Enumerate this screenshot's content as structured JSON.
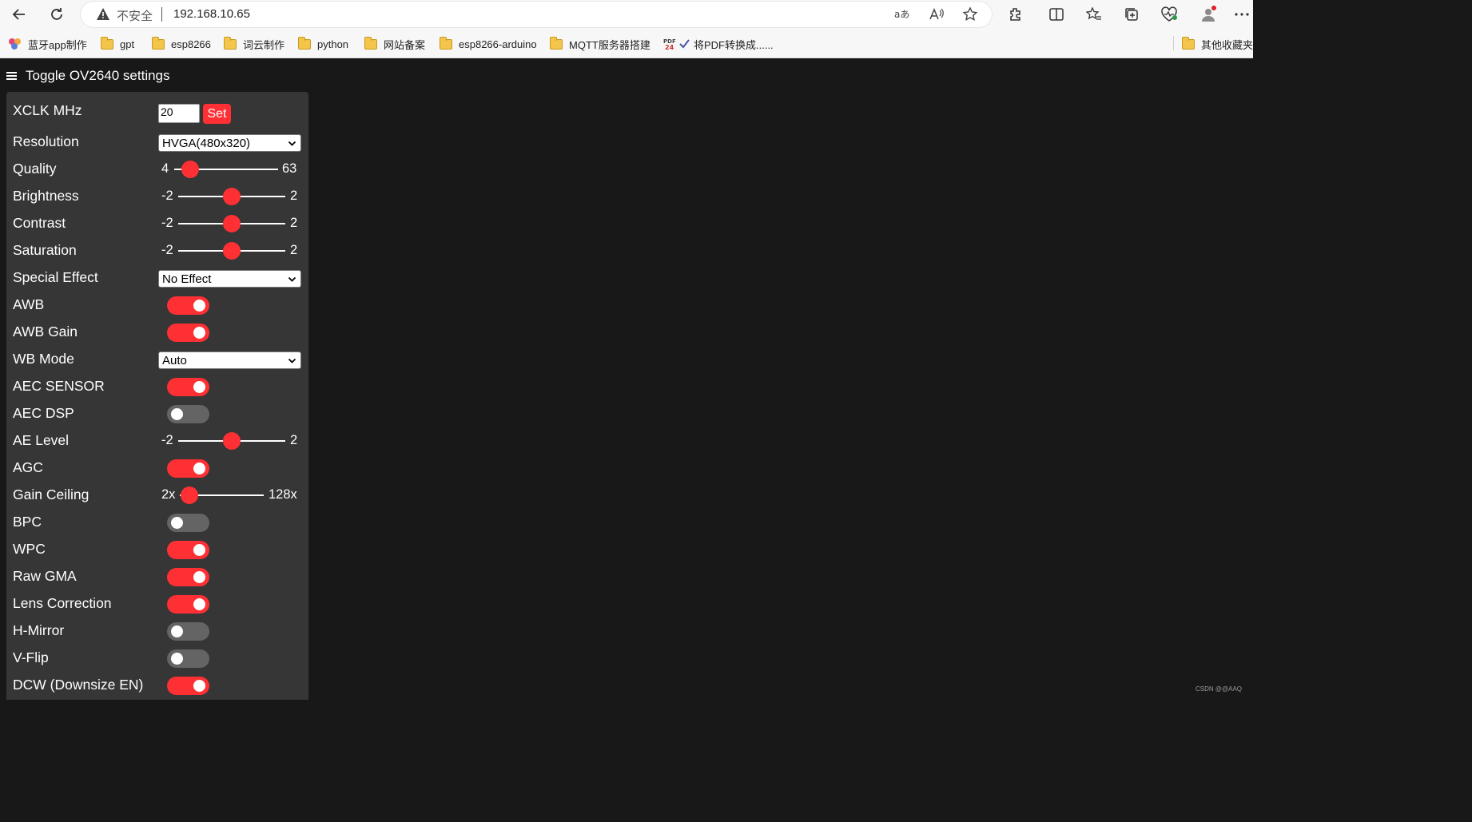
{
  "browser": {
    "insecure_label": "不安全",
    "url": "192.168.10.65"
  },
  "bookmarks": [
    {
      "label": "蓝牙app制作",
      "icon": "app-icon"
    },
    {
      "label": "gpt",
      "icon": "folder-icon"
    },
    {
      "label": "esp8266",
      "icon": "folder-icon"
    },
    {
      "label": "词云制作",
      "icon": "folder-icon"
    },
    {
      "label": "python",
      "icon": "folder-icon"
    },
    {
      "label": "网站备案",
      "icon": "folder-icon"
    },
    {
      "label": "esp8266-arduino",
      "icon": "folder-icon"
    },
    {
      "label": "MQTT服务器搭建",
      "icon": "folder-icon"
    },
    {
      "label": "将PDF转换成......",
      "icon": "pdf24-icon"
    }
  ],
  "other_bookmarks": "其他收藏夹",
  "page": {
    "toggle_label": "Toggle OV2640 settings",
    "xclk": {
      "label": "XCLK MHz",
      "value": "20",
      "button": "Set"
    },
    "resolution": {
      "label": "Resolution",
      "value": "HVGA(480x320)"
    },
    "quality": {
      "label": "Quality",
      "min": "4",
      "max": "63",
      "value": 10
    },
    "brightness": {
      "label": "Brightness",
      "min": "-2",
      "max": "2",
      "value": 0
    },
    "contrast": {
      "label": "Contrast",
      "min": "-2",
      "max": "2",
      "value": 0
    },
    "saturation": {
      "label": "Saturation",
      "min": "-2",
      "max": "2",
      "value": 0
    },
    "special_effect": {
      "label": "Special Effect",
      "value": "No Effect"
    },
    "awb": {
      "label": "AWB",
      "on": true
    },
    "awb_gain": {
      "label": "AWB Gain",
      "on": true
    },
    "wb_mode": {
      "label": "WB Mode",
      "value": "Auto"
    },
    "aec_sensor": {
      "label": "AEC SENSOR",
      "on": true
    },
    "aec_dsp": {
      "label": "AEC DSP",
      "on": false
    },
    "ae_level": {
      "label": "AE Level",
      "min": "-2",
      "max": "2",
      "value": 0
    },
    "agc": {
      "label": "AGC",
      "on": true
    },
    "gain_ceiling": {
      "label": "Gain Ceiling",
      "min": "2x",
      "max": "128x",
      "value": 0
    },
    "bpc": {
      "label": "BPC",
      "on": false
    },
    "wpc": {
      "label": "WPC",
      "on": true
    },
    "raw_gma": {
      "label": "Raw GMA",
      "on": true
    },
    "lens_correction": {
      "label": "Lens Correction",
      "on": true
    },
    "h_mirror": {
      "label": "H-Mirror",
      "on": false
    },
    "v_flip": {
      "label": "V-Flip",
      "on": false
    },
    "dcw": {
      "label": "DCW (Downsize EN)",
      "on": true
    }
  },
  "watermark": "CSDN @@AAQ",
  "colors": {
    "accent": "#ff3034",
    "panel": "#363636",
    "background": "#181818",
    "switch_off": "#646464"
  }
}
